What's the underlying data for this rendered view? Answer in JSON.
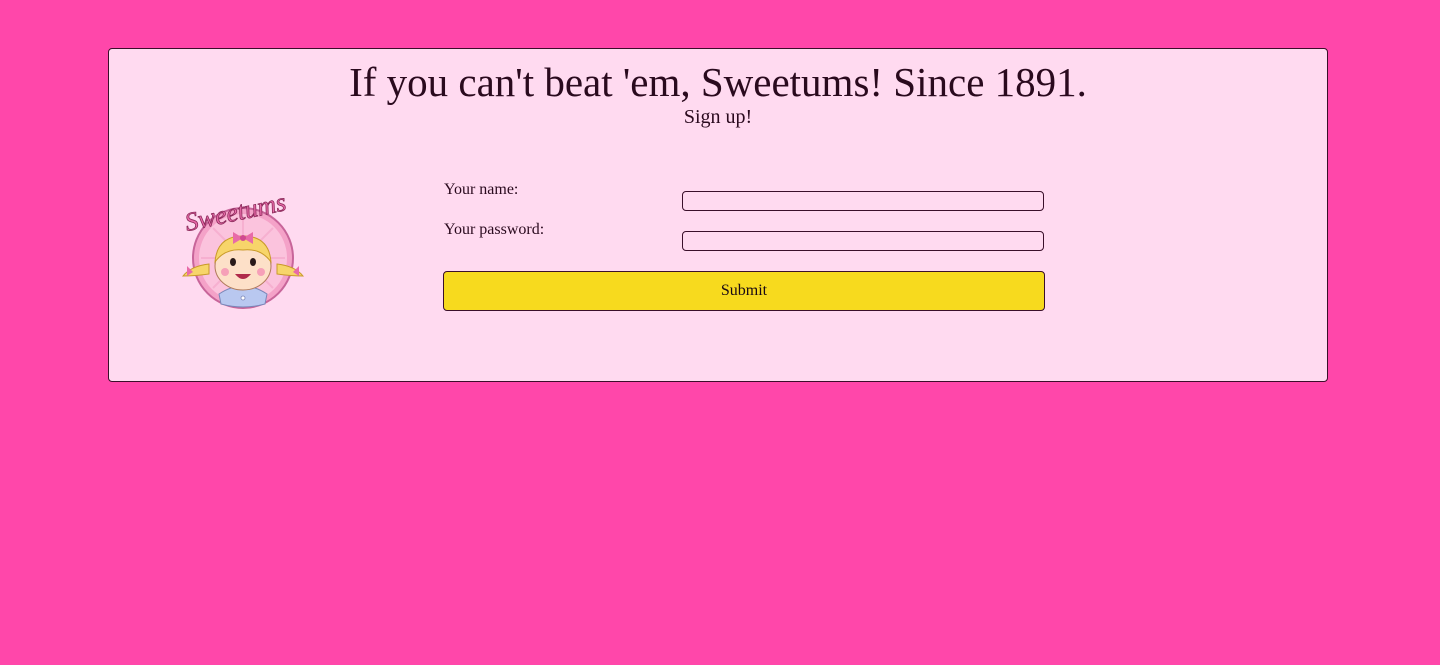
{
  "header": {
    "headline": "If you can't beat 'em, Sweetums! Since 1891.",
    "subheadline": "Sign up!"
  },
  "logo": {
    "text": "Sweetums",
    "icon": "sweetums-girl-logo"
  },
  "form": {
    "name_label": "Your name:",
    "name_value": "",
    "password_label": "Your password:",
    "password_value": "",
    "submit_label": "Submit"
  },
  "colors": {
    "page_background": "#ff47aa",
    "card_background": "#ffdaf0",
    "button_background": "#f7da1e",
    "text": "#2a0a1e"
  }
}
